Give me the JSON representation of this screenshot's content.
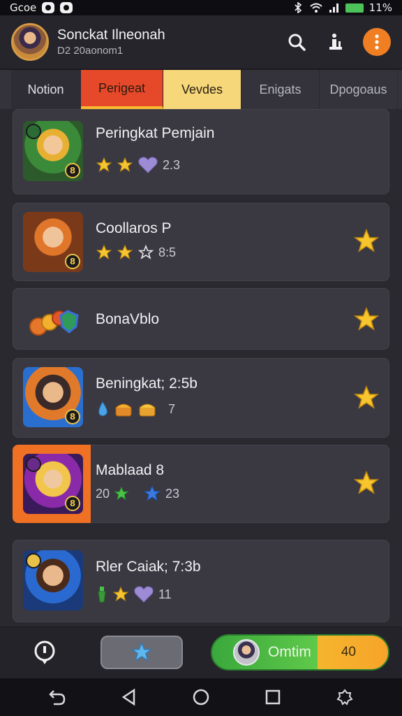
{
  "status_bar": {
    "left_text": "Gcoe",
    "battery_text": "11%",
    "colors": {
      "battery": "#4ec25a"
    }
  },
  "header": {
    "profile_name": "Sonckat Ilneonah",
    "profile_sub": "D2 20aonom1",
    "icons": [
      "search-icon",
      "info-icon",
      "more-icon"
    ],
    "accent": "#f07f24"
  },
  "tabs": [
    {
      "label": "Notion"
    },
    {
      "label": "Perigeat"
    },
    {
      "label": "Vevdes"
    },
    {
      "label": "Enigats"
    },
    {
      "label": "Dpogoaus"
    }
  ],
  "list": [
    {
      "title": "Peringkat Pemjain",
      "meta_value": "2.3",
      "badge": "8",
      "meta_icons": [
        "star-icon",
        "star-icon",
        "heart-icon"
      ],
      "has_right_star": false
    },
    {
      "title": "Coollaros P",
      "meta_value": "8:5",
      "badge": "8",
      "meta_icons": [
        "star-icon",
        "star-icon",
        "star-outline-icon"
      ],
      "has_right_star": true
    },
    {
      "title": "BonaVblo",
      "meta_value": "",
      "badge": "",
      "meta_icons": [],
      "has_right_star": true
    },
    {
      "title": "Beningkat; 2:5b",
      "meta_value": "7",
      "badge": "8",
      "meta_icons": [
        "drop-icon",
        "chest-icon",
        "chest-icon"
      ],
      "has_right_star": true
    },
    {
      "title": "Mablaad 8",
      "meta_prefix": "20",
      "meta_value": "23",
      "badge": "8",
      "meta_icons": [
        "star-icon",
        "star-icon"
      ],
      "has_right_star": true
    },
    {
      "title": "Rler Caiak; 7:3b",
      "meta_value": "11",
      "badge": "",
      "meta_icons": [
        "bottle-icon",
        "star-icon",
        "heart-icon"
      ],
      "has_right_star": false
    }
  ],
  "bottom_bar": {
    "confirm_label": "Omtim",
    "confirm_count": "40",
    "colors": {
      "confirm_green": "#4cba42",
      "confirm_orange": "#f5b52d"
    }
  }
}
